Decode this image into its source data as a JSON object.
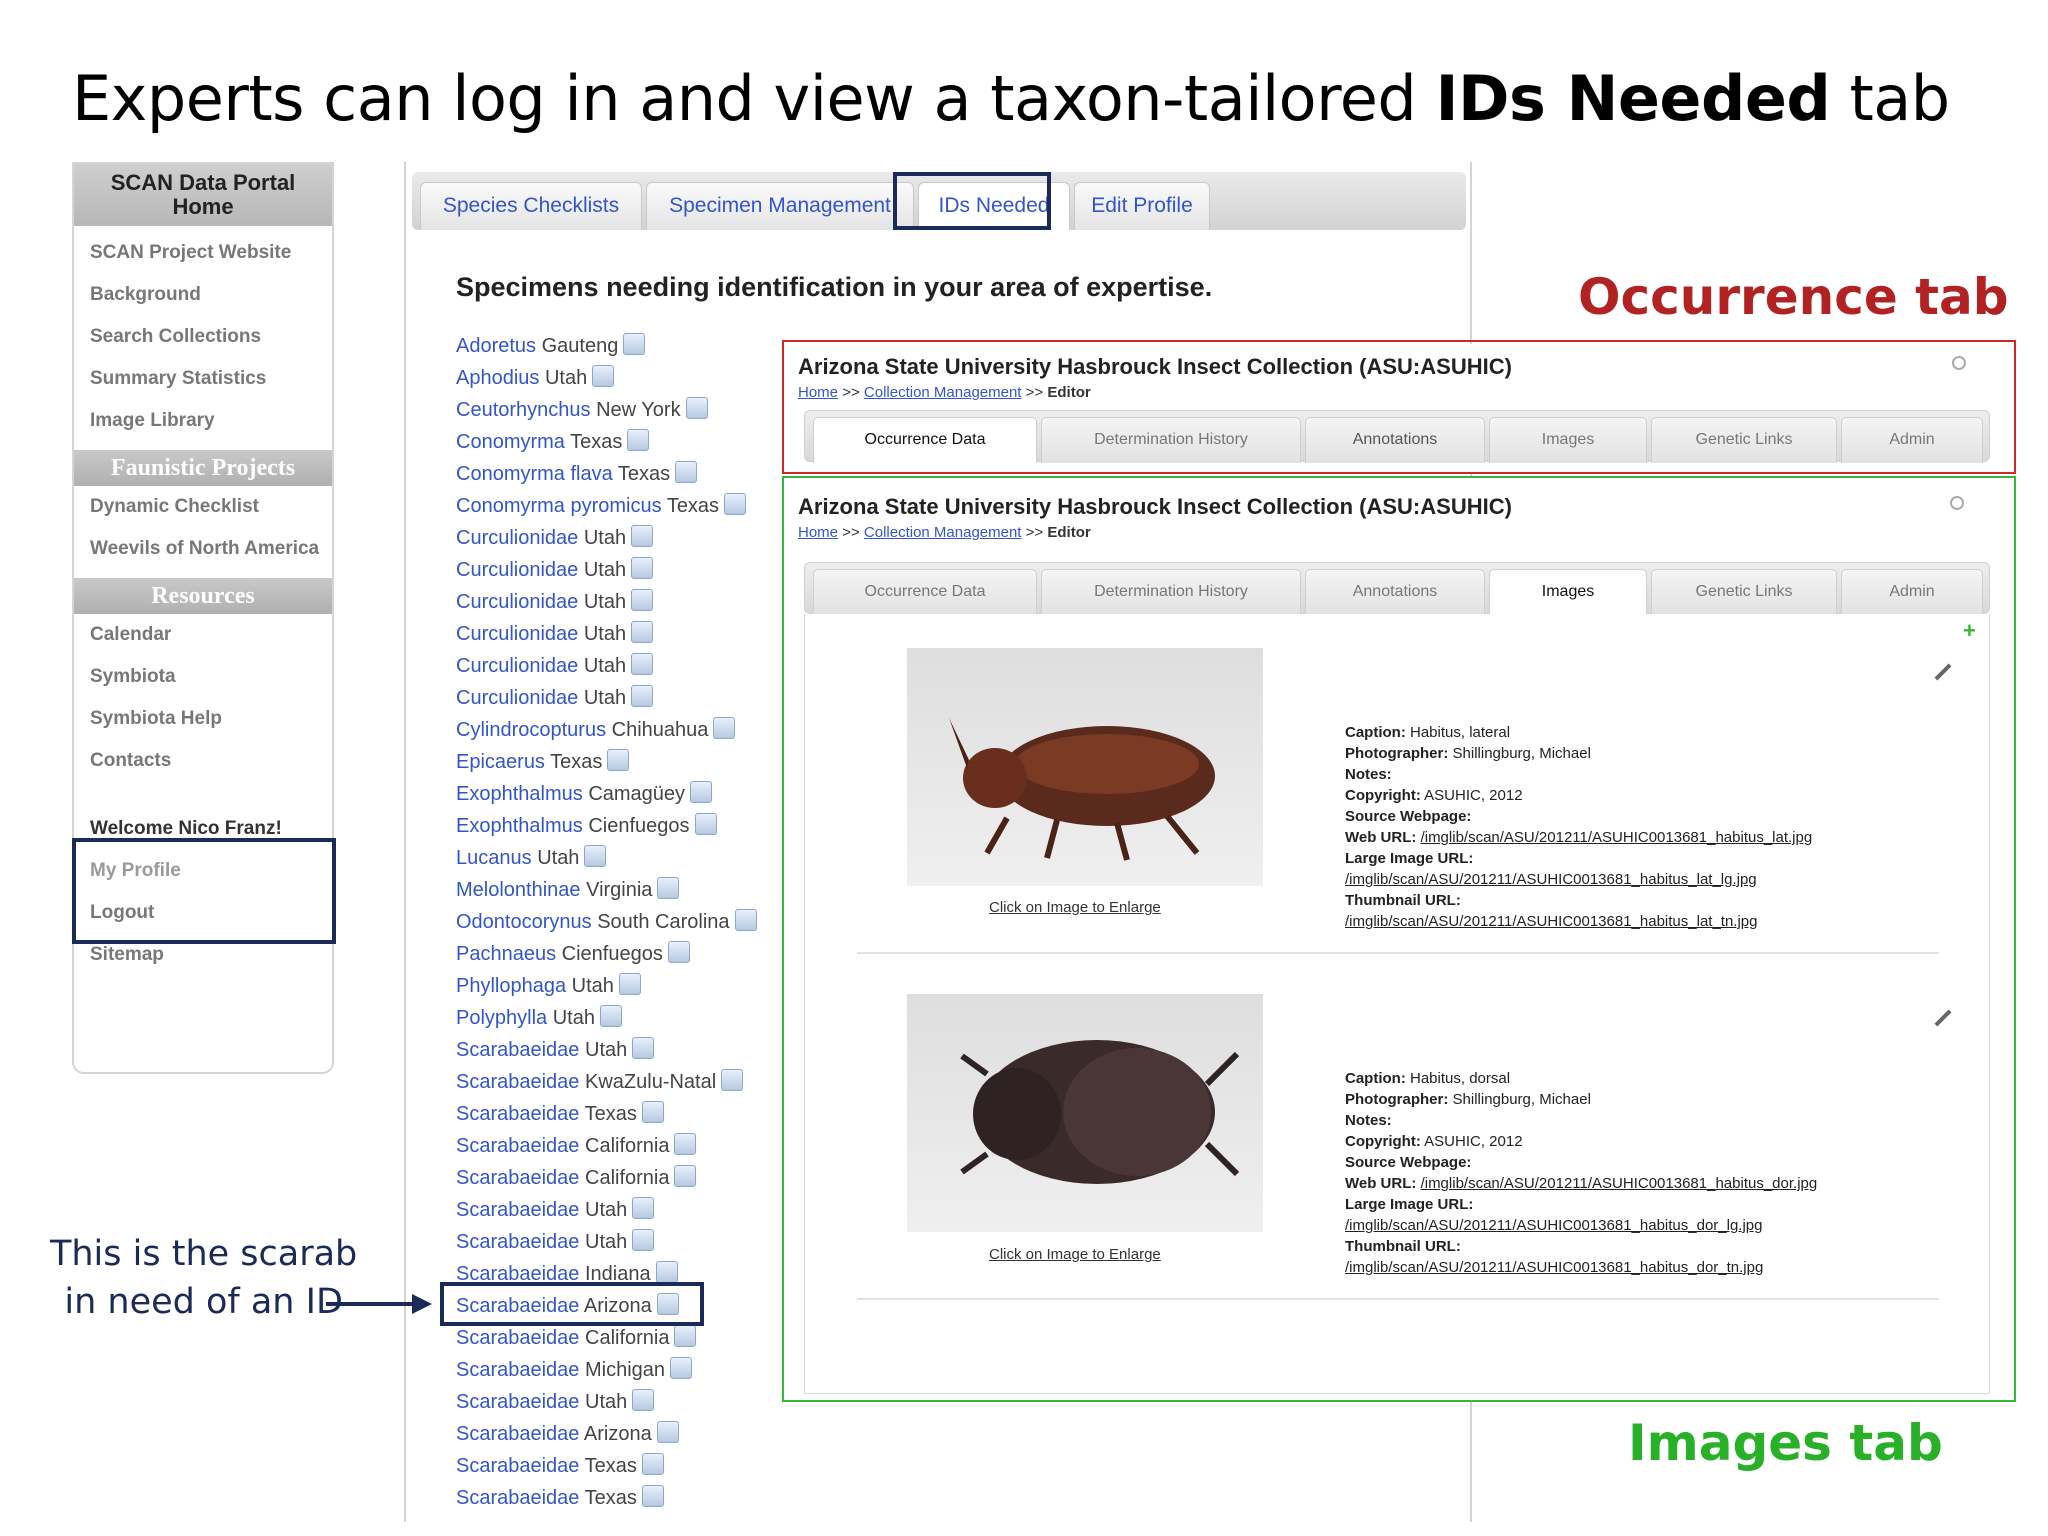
{
  "slide": {
    "title_pre": "Experts can log in and view a taxon-tailored ",
    "title_bold": "IDs Needed",
    "title_post": " tab"
  },
  "nav": {
    "header": "SCAN Data Portal Home",
    "links_top": [
      "SCAN Project Website",
      "Background",
      "Search Collections",
      "Summary Statistics",
      "Image Library"
    ],
    "faunistic_header": "Faunistic Projects",
    "faunistic_links": [
      "Dynamic Checklist",
      "Weevils of North America"
    ],
    "resources_header": "Resources",
    "resource_links": [
      "Calendar",
      "Symbiota",
      "Symbiota Help",
      "Contacts"
    ],
    "welcome": "Welcome Nico Franz!",
    "my_profile": "My Profile",
    "logout": "Logout",
    "sitemap": "Sitemap"
  },
  "main": {
    "tabs": [
      "Species Checklists",
      "Specimen Management",
      "IDs Needed",
      "Edit Profile"
    ],
    "heading": "Specimens needing identification in your area of expertise.",
    "specimens": [
      {
        "taxon": "Adoretus",
        "loc": "Gauteng"
      },
      {
        "taxon": "Aphodius",
        "loc": "Utah"
      },
      {
        "taxon": "Ceutorhynchus",
        "loc": "New York"
      },
      {
        "taxon": "Conomyrma",
        "loc": "Texas"
      },
      {
        "taxon": "Conomyrma flava",
        "loc": "Texas"
      },
      {
        "taxon": "Conomyrma pyromicus",
        "loc": "Texas"
      },
      {
        "taxon": "Curculionidae",
        "loc": "Utah"
      },
      {
        "taxon": "Curculionidae",
        "loc": "Utah"
      },
      {
        "taxon": "Curculionidae",
        "loc": "Utah"
      },
      {
        "taxon": "Curculionidae",
        "loc": "Utah"
      },
      {
        "taxon": "Curculionidae",
        "loc": "Utah"
      },
      {
        "taxon": "Curculionidae",
        "loc": "Utah"
      },
      {
        "taxon": "Cylindrocopturus",
        "loc": "Chihuahua"
      },
      {
        "taxon": "Epicaerus",
        "loc": "Texas"
      },
      {
        "taxon": "Exophthalmus",
        "loc": "Camagüey"
      },
      {
        "taxon": "Exophthalmus",
        "loc": "Cienfuegos"
      },
      {
        "taxon": "Lucanus",
        "loc": "Utah"
      },
      {
        "taxon": "Melolonthinae",
        "loc": "Virginia"
      },
      {
        "taxon": "Odontocorynus",
        "loc": "South Carolina"
      },
      {
        "taxon": "Pachnaeus",
        "loc": "Cienfuegos"
      },
      {
        "taxon": "Phyllophaga",
        "loc": "Utah"
      },
      {
        "taxon": "Polyphylla",
        "loc": "Utah"
      },
      {
        "taxon": "Scarabaeidae",
        "loc": "Utah"
      },
      {
        "taxon": "Scarabaeidae",
        "loc": "KwaZulu-Natal"
      },
      {
        "taxon": "Scarabaeidae",
        "loc": "Texas"
      },
      {
        "taxon": "Scarabaeidae",
        "loc": "California"
      },
      {
        "taxon": "Scarabaeidae",
        "loc": "California"
      },
      {
        "taxon": "Scarabaeidae",
        "loc": "Utah"
      },
      {
        "taxon": "Scarabaeidae",
        "loc": "Utah"
      },
      {
        "taxon": "Scarabaeidae",
        "loc": "Indiana"
      },
      {
        "taxon": "Scarabaeidae",
        "loc": "Arizona"
      },
      {
        "taxon": "Scarabaeidae",
        "loc": "California"
      },
      {
        "taxon": "Scarabaeidae",
        "loc": "Michigan"
      },
      {
        "taxon": "Scarabaeidae",
        "loc": "Utah"
      },
      {
        "taxon": "Scarabaeidae",
        "loc": "Arizona"
      },
      {
        "taxon": "Scarabaeidae",
        "loc": "Texas"
      },
      {
        "taxon": "Scarabaeidae",
        "loc": "Texas"
      }
    ]
  },
  "record": {
    "title": "Arizona State University Hasbrouck Insect Collection (ASU:ASUHIC)",
    "crumb_home": "Home",
    "crumb_sep": ">>",
    "crumb_mgmt": "Collection Management",
    "crumb_editor": "Editor",
    "tabs": [
      "Occurrence Data",
      "Determination History",
      "Annotations",
      "Images",
      "Genetic Links",
      "Admin"
    ]
  },
  "images": [
    {
      "click_caption": "Click on Image to Enlarge",
      "caption_label": "Caption:",
      "caption": "Habitus, lateral",
      "photographer_label": "Photographer:",
      "photographer": "Shillingburg, Michael",
      "notes_label": "Notes:",
      "copyright_label": "Copyright:",
      "copyright": "ASUHIC, 2012",
      "source_label": "Source Webpage:",
      "web_label": "Web URL:",
      "web_url": "/imglib/scan/ASU/201211/ASUHIC0013681_habitus_lat.jpg",
      "large_label": "Large Image URL:",
      "large_url": "/imglib/scan/ASU/201211/ASUHIC0013681_habitus_lat_lg.jpg",
      "thumb_label": "Thumbnail URL:",
      "thumb_url": "/imglib/scan/ASU/201211/ASUHIC0013681_habitus_lat_tn.jpg"
    },
    {
      "click_caption": "Click on Image to Enlarge",
      "caption_label": "Caption:",
      "caption": "Habitus, dorsal",
      "photographer_label": "Photographer:",
      "photographer": "Shillingburg, Michael",
      "notes_label": "Notes:",
      "copyright_label": "Copyright:",
      "copyright": "ASUHIC, 2012",
      "source_label": "Source Webpage:",
      "web_label": "Web URL:",
      "web_url": "/imglib/scan/ASU/201211/ASUHIC0013681_habitus_dor.jpg",
      "large_label": "Large Image URL:",
      "large_url": "/imglib/scan/ASU/201211/ASUHIC0013681_habitus_dor_lg.jpg",
      "thumb_label": "Thumbnail URL:",
      "thumb_url": "/imglib/scan/ASU/201211/ASUHIC0013681_habitus_dor_tn.jpg"
    }
  ],
  "annotations": {
    "occurrence_tab": "Occurrence tab",
    "images_tab": "Images tab",
    "scarab_line1": "This is the scarab",
    "scarab_line2": "in need of an ID"
  },
  "colors": {
    "navy_box": "#1b2b57",
    "red_box": "#d02828",
    "green_box": "#36b536",
    "link_blue": "#3355cc"
  },
  "icons": {
    "specimen_image": "image-icon",
    "search": "zoom-icon",
    "edit": "pencil-icon",
    "add": "plus-icon"
  }
}
